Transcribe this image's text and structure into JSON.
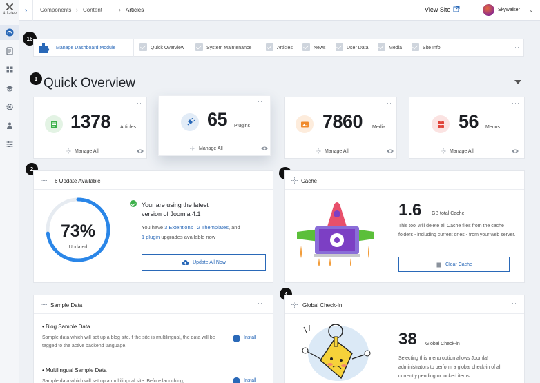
{
  "app": {
    "version": "4.1-dev",
    "breadcrumbs": [
      "Components",
      "Content",
      "Articles"
    ],
    "view_site": "View Site",
    "user": "Skywalker"
  },
  "toolbar": {
    "manage_label": "Manage Dashboard Module",
    "modules": [
      "Quick Overview",
      "System Maintenance",
      "Articles",
      "News",
      "User Data",
      "Media",
      "Site Info"
    ]
  },
  "badges": {
    "b16": "16",
    "b1": "1",
    "b2": "2",
    "b3": "3",
    "b4": "4"
  },
  "quick_overview": {
    "title": "Quick Overview",
    "manage_all": "Manage All",
    "stats": [
      {
        "value": "1378",
        "label": "Articles",
        "color": "#3cb04a"
      },
      {
        "value": "65",
        "label": "Plugins",
        "color": "#2a69b8"
      },
      {
        "value": "7860",
        "label": "Media",
        "color": "#f08a2b"
      },
      {
        "value": "56",
        "label": "Menus",
        "color": "#e0443a"
      }
    ]
  },
  "updates": {
    "title": "6 Update Available",
    "percent": "73%",
    "percent_value": 73,
    "percent_label": "Updated",
    "headline_1": "Your are using the latest",
    "headline_2": "version of Joomla 4.1",
    "text_1": "You have ",
    "link_1": "3 Extentions",
    "text_2": " , ",
    "link_2": "2 Themplates",
    "text_3": ", and",
    "link_3": "1 plugin",
    "text_4": " upgrades available now",
    "button": "Update All Now",
    "accent": "#2a86e8"
  },
  "cache": {
    "title": "Cache",
    "value": "1.6",
    "unit": "GB total Cache",
    "description": "This tool will delete all Cache files from the cache folders - including current ones - from your web server.",
    "button": "Clear Cache"
  },
  "sample": {
    "title": "Sample Data",
    "items": [
      {
        "title": "• Blog Sample Data",
        "desc": "Sample data which will set up a blog site.If the site is multilingual, the data will be tagged to the active backend language.",
        "action": "Install"
      },
      {
        "title": "• Multilingual Sample Data",
        "desc": "Sample data which will set up a multilingual site. Before launching,",
        "action": "Install"
      }
    ]
  },
  "checkin": {
    "title": "Global Check-In",
    "value": "38",
    "unit": "Global Check-in",
    "description": "Selecting this menu option allows Joomla! administrators to perform a global check-in of all currently pending or locked items."
  },
  "icons": {
    "sidebar": [
      "dashboard-icon",
      "content-icon",
      "components-icon",
      "users-icon",
      "system-icon",
      "extensions-icon",
      "settings-icon"
    ]
  }
}
